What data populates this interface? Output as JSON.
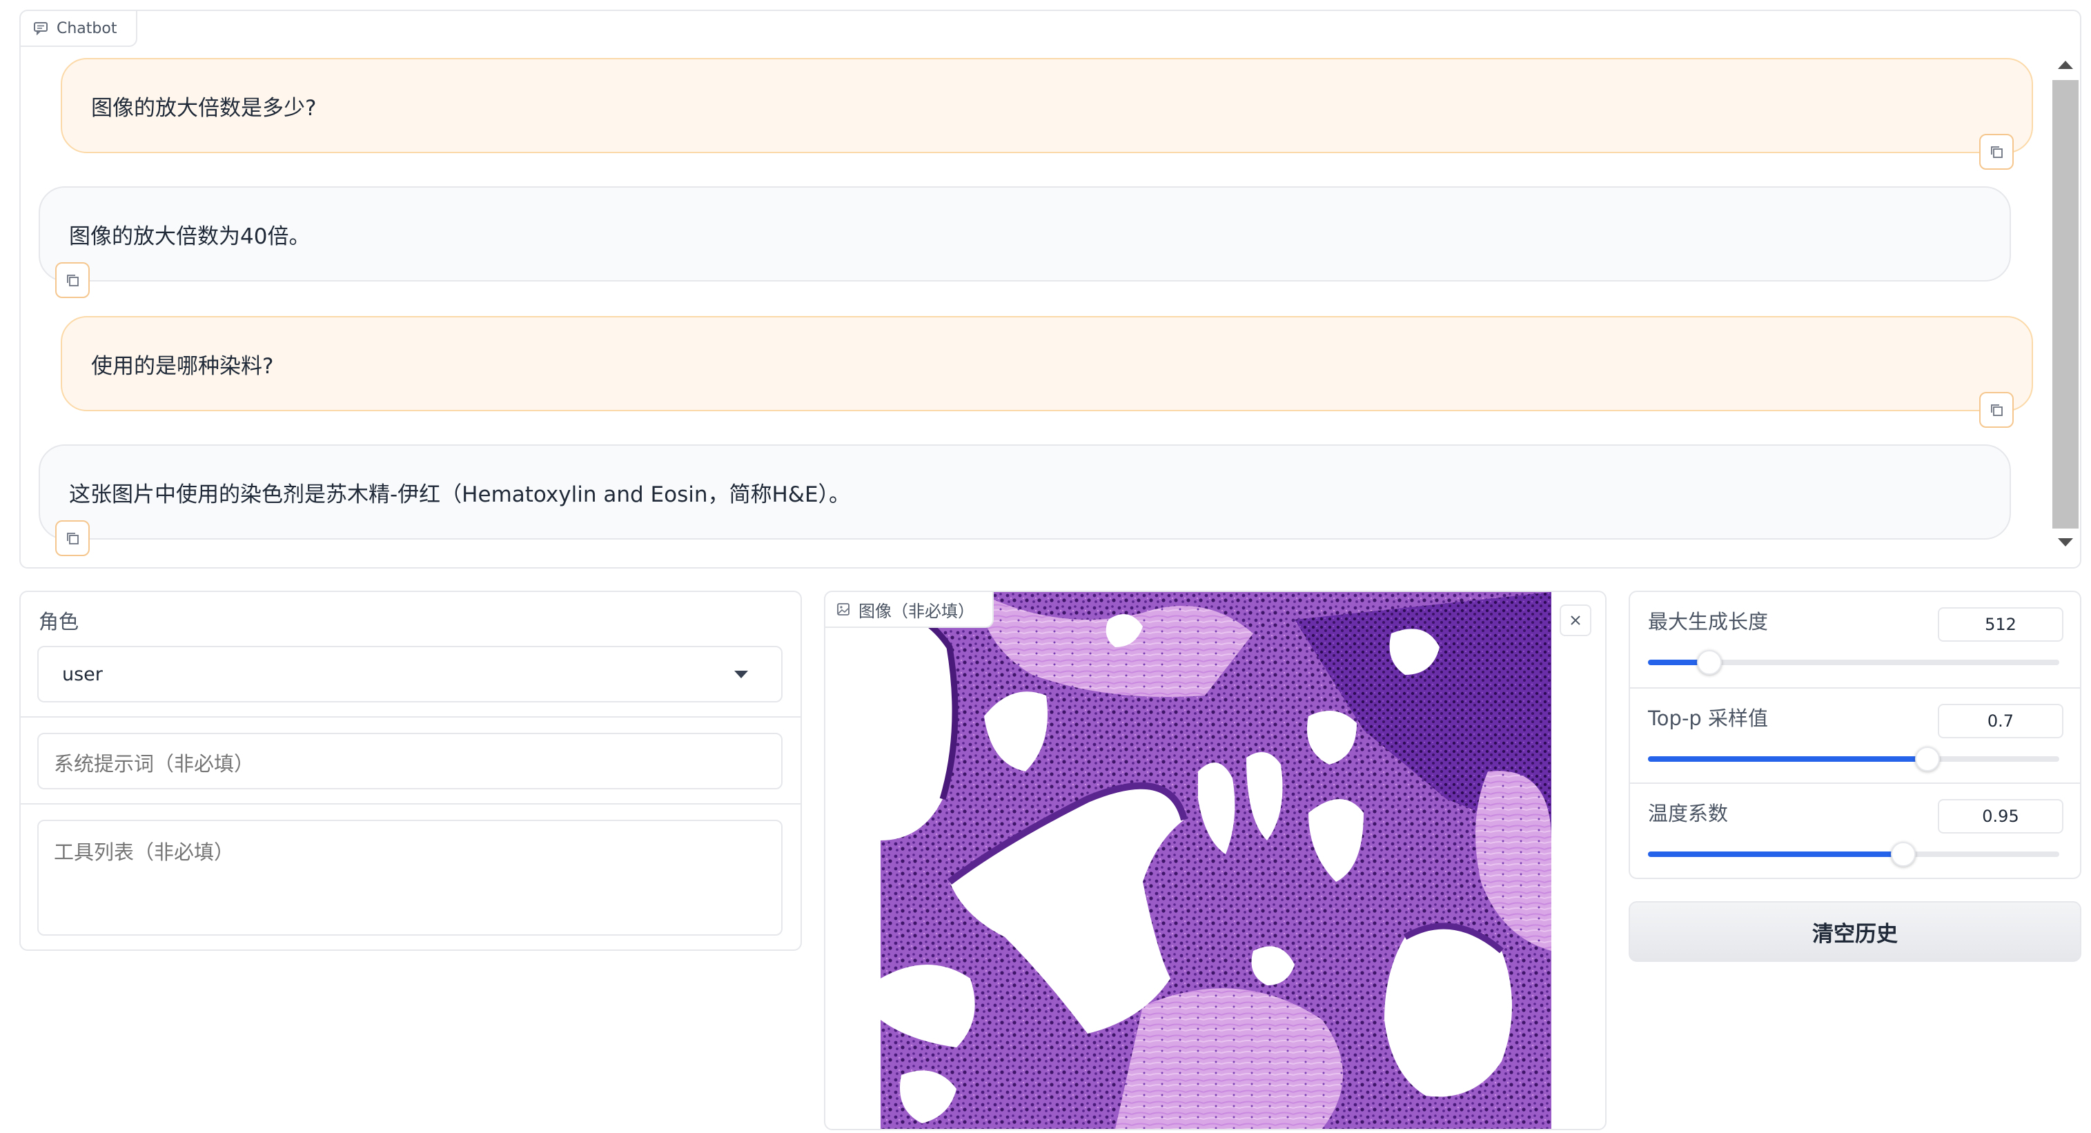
{
  "chatbot": {
    "label": "Chatbot",
    "messages": [
      {
        "role": "user",
        "text": "图像的放大倍数是多少?"
      },
      {
        "role": "assistant",
        "text": "图像的放大倍数为40倍。"
      },
      {
        "role": "user",
        "text": "使用的是哪种染料?"
      },
      {
        "role": "assistant",
        "text": "这张图片中使用的染色剂是苏木精-伊红（Hematoxylin and Eosin，简称H&E）。"
      }
    ]
  },
  "left_panel": {
    "role_label": "角色",
    "role_value": "user",
    "system_prompt_placeholder": "系统提示词（非必填）",
    "tools_placeholder": "工具列表（非必填）"
  },
  "image_panel": {
    "label": "图像（非必填）"
  },
  "settings": {
    "max_length": {
      "label": "最大生成长度",
      "value": "512",
      "fraction": 0.15
    },
    "top_p": {
      "label": "Top-p 采样值",
      "value": "0.7",
      "fraction": 0.68
    },
    "temperature": {
      "label": "温度系数",
      "value": "0.95",
      "fraction": 0.62
    }
  },
  "clear_button": {
    "label": "清空历史"
  },
  "colors": {
    "user_bubble": "#fff7ed",
    "user_border": "#fcd9a8",
    "bot_bubble": "#f9fafb",
    "slider_fill": "#2563eb",
    "stain_purple": "#7a3fb3",
    "stain_pink": "#d68fd6"
  },
  "icons": {
    "chat": "chat-bubble-icon",
    "copy": "copy-icon",
    "image": "image-icon",
    "close": "close-icon",
    "dropdown": "caret-down-icon"
  }
}
